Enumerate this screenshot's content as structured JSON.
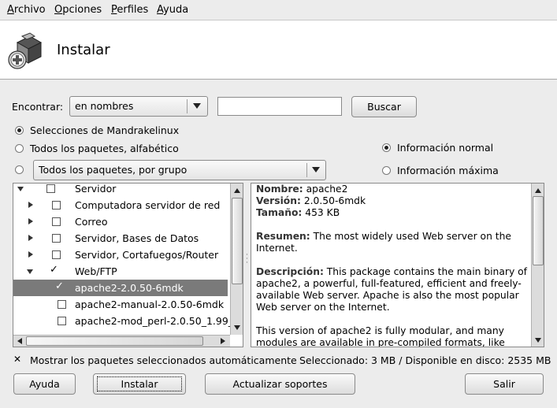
{
  "menubar": {
    "items": [
      "Archivo",
      "Opciones",
      "Perfiles",
      "Ayuda"
    ]
  },
  "header": {
    "title": "Instalar",
    "icon": "install-package-icon"
  },
  "search": {
    "label": "Encontrar:",
    "mode_value": "en nombres",
    "query": "",
    "button": "Buscar"
  },
  "view_options": {
    "radio1": "Selecciones de Mandrakelinux",
    "radio2": "Todos los paquetes, alfabético",
    "radio3_combo": "Todos los paquetes, por grupo",
    "selected": "radio1"
  },
  "info_options": {
    "normal": "Información normal",
    "max": "Información máxima",
    "selected": "normal"
  },
  "tree": {
    "rows": [
      {
        "label": "Servidor",
        "expander": "open",
        "checked": false
      },
      {
        "label": "Computadora servidor de red",
        "expander": "closed",
        "checked": false
      },
      {
        "label": "Correo",
        "expander": "closed",
        "checked": false
      },
      {
        "label": "Servidor, Bases de Datos",
        "expander": "closed",
        "checked": false
      },
      {
        "label": "Servidor, Cortafuegos/Router",
        "expander": "closed",
        "checked": false
      },
      {
        "label": "Web/FTP",
        "expander": "open",
        "checked": true
      },
      {
        "label": "apache2-2.0.50-6mdk",
        "expander": "none",
        "checked": true,
        "selected": true
      },
      {
        "label": "apache2-manual-2.0.50-6mdk",
        "expander": "none",
        "checked": false
      },
      {
        "label": "apache2-mod_perl-2.0.50_1.99_",
        "expander": "none",
        "checked": false
      }
    ]
  },
  "details": {
    "name_label": "Nombre:",
    "name": "apache2",
    "version_label": "Versión:",
    "version": "2.0.50-6mdk",
    "size_label": "Tamaño:",
    "size": "453 KB",
    "summary_label": "Resumen:",
    "summary": "The most widely used Web server on the Internet.",
    "description_label": "Descripción:",
    "description": "This package contains the main binary of apache2, a powerful, full-featured, efficient and freely-available Web server. Apache is also the most popular Web server on the Internet.",
    "extra": "This version of apache2 is fully modular, and many modules are available in pre-compiled formats, like"
  },
  "footer": {
    "auto_show": "Mostrar los paquetes seleccionados automáticamente",
    "auto_checked": true,
    "status": "Seleccionado: 3 MB / Disponible en disco: 2535 MB"
  },
  "buttons": {
    "help": "Ayuda",
    "install": "Instalar",
    "update_media": "Actualizar soportes",
    "quit": "Salir"
  }
}
